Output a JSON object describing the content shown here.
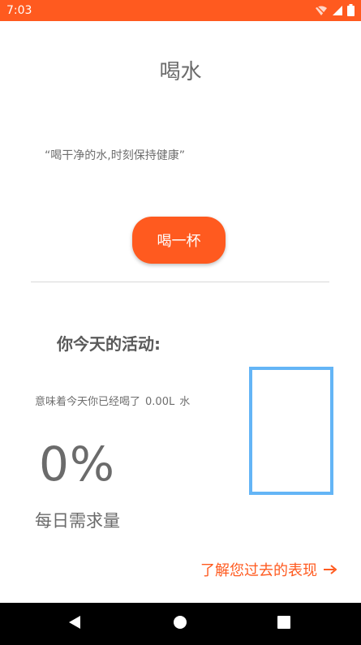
{
  "status_bar": {
    "time": "7:03",
    "icons": [
      "wifi-off-icon",
      "signal-icon",
      "battery-icon"
    ],
    "color": "#ff5a1f"
  },
  "screen": {
    "title": "喝水",
    "quote": "“喝干净的水,时刻保持健康”",
    "drink_button_label": "喝一杯"
  },
  "activity": {
    "heading": "你今天的活动:",
    "drank_prefix": "意味着今天你已经喝了",
    "drank_amount": "0.00L",
    "drank_unit": "水",
    "percent": "0%",
    "percent_value": 0,
    "daily_need_label": "每日需求量"
  },
  "history_link": {
    "label": "了解您过去的表现",
    "icon": "arrow-right-icon"
  },
  "nav_bar": {
    "buttons": [
      "back-icon",
      "home-icon",
      "recents-icon"
    ]
  },
  "colors": {
    "accent": "#ff5a1f",
    "glass": "#64b5f6",
    "text": "#6b6b6b"
  }
}
